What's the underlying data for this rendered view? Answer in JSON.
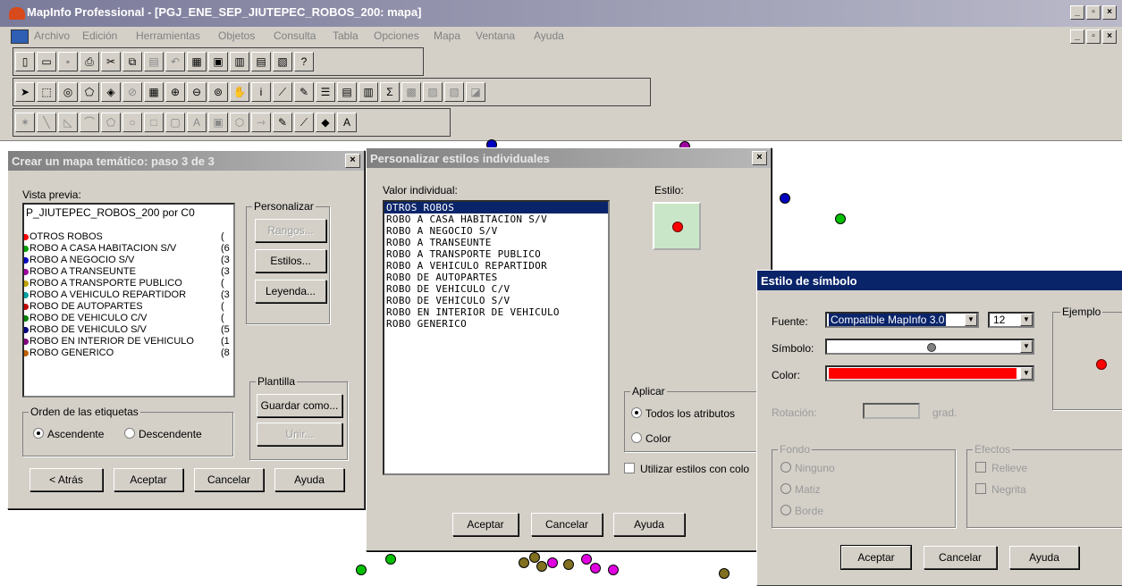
{
  "app": {
    "title": "MapInfo Professional - [PGJ_ENE_SEP_JIUTEPEC_ROBOS_200: mapa]",
    "window_buttons": [
      "_",
      "▫",
      "×"
    ]
  },
  "menu": [
    "Archivo",
    "Edición",
    "Herramientas",
    "Objetos",
    "Consulta",
    "Tabla",
    "Opciones",
    "Mapa",
    "Ventana",
    "Ayuda"
  ],
  "toolbar1": [
    "new-icon",
    "open-icon",
    "save-icon",
    "print-icon",
    "cut-icon",
    "copy-icon",
    "paste-icon",
    "undo-icon",
    "browser-icon",
    "mapper-icon",
    "grapher-icon",
    "layout-icon",
    "redistrict-icon",
    "help-cursor-icon"
  ],
  "toolbar2": [
    "select-icon",
    "marquee-icon",
    "radius-icon",
    "polygon-select-icon",
    "boundary-icon",
    "unselect-icon",
    "graph-select-icon",
    "zoom-in-icon",
    "zoom-out-icon",
    "change-view-icon",
    "grabber-icon",
    "info-icon",
    "ruler-icon",
    "label-icon",
    "layer-control-icon",
    "legend-icon",
    "statistics-icon",
    "sum-icon",
    "find-icon",
    "drag-window-icon",
    "hotlink-icon",
    "clip-icon"
  ],
  "toolbar3": [
    "symbol-tool-icon",
    "line-tool-icon",
    "polyline-tool-icon",
    "arc-tool-icon",
    "polygon-tool-icon",
    "ellipse-tool-icon",
    "rectangle-tool-icon",
    "rounded-rect-tool-icon",
    "text-tool-icon",
    "frame-tool-icon",
    "reshape-icon",
    "add-node-icon",
    "symbol-style-icon",
    "line-style-icon",
    "region-style-icon",
    "text-style-icon"
  ],
  "wizard": {
    "title": "Crear un mapa temático: paso 3 de 3",
    "preview_label": "Vista previa:",
    "legend_title": "P_JIUTEPEC_ROBOS_200 por C0",
    "legend_items": [
      {
        "label": "OTROS ROBOS",
        "count": "(",
        "color": "#ff0000"
      },
      {
        "label": "ROBO A CASA HABITACION S/V",
        "count": "(6",
        "color": "#00a000"
      },
      {
        "label": "ROBO A NEGOCIO S/V",
        "count": "(3",
        "color": "#0000c0"
      },
      {
        "label": "ROBO A TRANSEUNTE",
        "count": "(3",
        "color": "#a000a0"
      },
      {
        "label": "ROBO A TRANSPORTE PUBLICO",
        "count": "(",
        "color": "#c0a000"
      },
      {
        "label": "ROBO A VEHICULO REPARTIDOR",
        "count": "(3",
        "color": "#00a0a0"
      },
      {
        "label": "ROBO DE AUTOPARTES",
        "count": "(",
        "color": "#c00000"
      },
      {
        "label": "ROBO DE VEHICULO C/V",
        "count": "(",
        "color": "#008000"
      },
      {
        "label": "ROBO DE VEHICULO S/V",
        "count": "(5",
        "color": "#000080"
      },
      {
        "label": "ROBO EN INTERIOR DE VEHICULO",
        "count": "(1",
        "color": "#800080"
      },
      {
        "label": "ROBO GENERICO",
        "count": "(8",
        "color": "#c06000"
      }
    ],
    "personalizar_label": "Personalizar",
    "rangos": "Rangos...",
    "estilos": "Estilos...",
    "leyenda": "Leyenda...",
    "plantilla_label": "Plantilla",
    "guardar": "Guardar como...",
    "unir": "Unir...",
    "orden_label": "Orden de las etiquetas",
    "ascendente": "Ascendente",
    "descendente": "Descendente",
    "atras": "< Atrás",
    "aceptar": "Aceptar",
    "cancelar": "Cancelar",
    "ayuda": "Ayuda"
  },
  "custom": {
    "title": "Personalizar estilos individuales",
    "valor_label": "Valor individual:",
    "estilo_label": "Estilo:",
    "values": [
      "OTROS ROBOS",
      "ROBO A CASA HABITACION S/V",
      "ROBO A NEGOCIO S/V",
      "ROBO A TRANSEUNTE",
      "ROBO A TRANSPORTE PUBLICO",
      "ROBO A VEHICULO REPARTIDOR",
      "ROBO DE AUTOPARTES",
      "ROBO DE VEHICULO C/V",
      "ROBO DE VEHICULO S/V",
      "ROBO EN INTERIOR DE VEHICULO",
      "ROBO GENERICO"
    ],
    "aplicar_label": "Aplicar",
    "todos": "Todos los atributos",
    "color": "Color",
    "utilizar": "Utilizar estilos con colo",
    "aceptar": "Aceptar",
    "cancelar": "Cancelar",
    "ayuda": "Ayuda"
  },
  "symbol": {
    "title": "Estilo de símbolo",
    "fuente_label": "Fuente:",
    "fuente_value": "Compatible MapInfo 3.0",
    "size_value": "12",
    "simbolo_label": "Símbolo:",
    "color_label": "Color:",
    "color_value": "#ff0000",
    "rotacion_label": "Rotación:",
    "grad_label": "grad.",
    "ejemplo_label": "Ejemplo",
    "fondo_label": "Fondo",
    "ninguno": "Ninguno",
    "matiz": "Matiz",
    "borde": "Borde",
    "efectos_label": "Efectos",
    "relieve": "Relieve",
    "negrita": "Negrita",
    "aceptar": "Aceptar",
    "cancelar": "Cancelar",
    "ayuda": "Ayuda"
  }
}
